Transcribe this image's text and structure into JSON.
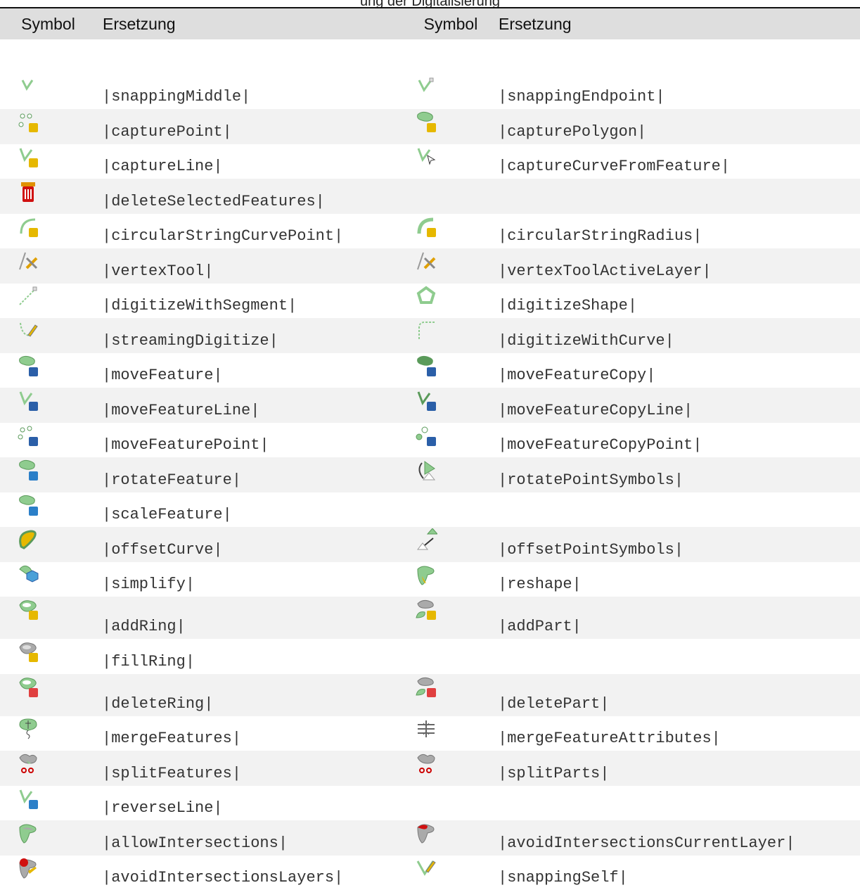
{
  "caption": "ung der Digitalisierung",
  "headers": {
    "symbol": "Symbol",
    "replacement": "Ersetzung"
  },
  "rows": [
    {
      "left": {
        "icon": "snapping-middle-icon",
        "code": "|snappingMiddle|"
      },
      "right": {
        "icon": "snapping-endpoint-icon",
        "code": "|snappingEndpoint|"
      }
    },
    {
      "left": {
        "icon": "capture-point-icon",
        "code": "|capturePoint|"
      },
      "right": {
        "icon": "capture-polygon-icon",
        "code": "|capturePolygon|"
      }
    },
    {
      "left": {
        "icon": "capture-line-icon",
        "code": "|captureLine|"
      },
      "right": {
        "icon": "capture-curve-from-feature-icon",
        "code": "|captureCurveFromFeature|"
      }
    },
    {
      "left": {
        "icon": "delete-selected-features-icon",
        "code": "|deleteSelectedFeatures|"
      },
      "right": null
    },
    {
      "left": {
        "icon": "circular-string-curve-point-icon",
        "code": "|circularStringCurvePoint|"
      },
      "right": {
        "icon": "circular-string-radius-icon",
        "code": "|circularStringRadius|"
      }
    },
    {
      "left": {
        "icon": "vertex-tool-icon",
        "code": "|vertexTool|"
      },
      "right": {
        "icon": "vertex-tool-active-layer-icon",
        "code": "|vertexToolActiveLayer|"
      }
    },
    {
      "left": {
        "icon": "digitize-with-segment-icon",
        "code": "|digitizeWithSegment|"
      },
      "right": {
        "icon": "digitize-shape-icon",
        "code": "|digitizeShape|"
      }
    },
    {
      "left": {
        "icon": "streaming-digitize-icon",
        "code": "|streamingDigitize|"
      },
      "right": {
        "icon": "digitize-with-curve-icon",
        "code": "|digitizeWithCurve|"
      }
    },
    {
      "left": {
        "icon": "move-feature-icon",
        "code": "|moveFeature|"
      },
      "right": {
        "icon": "move-feature-copy-icon",
        "code": "|moveFeatureCopy|"
      }
    },
    {
      "left": {
        "icon": "move-feature-line-icon",
        "code": "|moveFeatureLine|"
      },
      "right": {
        "icon": "move-feature-copy-line-icon",
        "code": "|moveFeatureCopyLine|"
      }
    },
    {
      "left": {
        "icon": "move-feature-point-icon",
        "code": "|moveFeaturePoint|"
      },
      "right": {
        "icon": "move-feature-copy-point-icon",
        "code": "|moveFeatureCopyPoint|"
      }
    },
    {
      "left": {
        "icon": "rotate-feature-icon",
        "code": "|rotateFeature|"
      },
      "right": {
        "icon": "rotate-point-symbols-icon",
        "code": "|rotatePointSymbols|"
      }
    },
    {
      "left": {
        "icon": "scale-feature-icon",
        "code": "|scaleFeature|"
      },
      "right": null
    },
    {
      "left": {
        "icon": "offset-curve-icon",
        "code": "|offsetCurve|"
      },
      "right": {
        "icon": "offset-point-symbols-icon",
        "code": "|offsetPointSymbols|"
      }
    },
    {
      "left": {
        "icon": "simplify-icon",
        "code": "|simplify|"
      },
      "right": {
        "icon": "reshape-icon",
        "code": "|reshape|"
      }
    },
    {
      "left": {
        "icon": "add-ring-icon",
        "code": "|addRing|"
      },
      "right": {
        "icon": "add-part-icon",
        "code": "|addPart|"
      }
    },
    {
      "left": {
        "icon": "fill-ring-icon",
        "code": "|fillRing|"
      },
      "right": null
    },
    {
      "left": {
        "icon": "delete-ring-icon",
        "code": "|deleteRing|"
      },
      "right": {
        "icon": "delete-part-icon",
        "code": "|deletePart|"
      }
    },
    {
      "left": {
        "icon": "merge-features-icon",
        "code": "|mergeFeatures|"
      },
      "right": {
        "icon": "merge-feature-attributes-icon",
        "code": "|mergeFeatureAttributes|"
      }
    },
    {
      "left": {
        "icon": "split-features-icon",
        "code": "|splitFeatures|"
      },
      "right": {
        "icon": "split-parts-icon",
        "code": "|splitParts|"
      }
    },
    {
      "left": {
        "icon": "reverse-line-icon",
        "code": "|reverseLine|"
      },
      "right": null
    },
    {
      "left": {
        "icon": "allow-intersections-icon",
        "code": "|allowIntersections|"
      },
      "right": {
        "icon": "avoid-intersections-current-layer-icon",
        "code": "|avoidIntersectionsCurrentLayer|"
      }
    },
    {
      "left": {
        "icon": "avoid-intersections-layers-icon",
        "code": "|avoidIntersectionsLayers|"
      },
      "right": {
        "icon": "snapping-self-icon",
        "code": "|snappingSelf|"
      }
    }
  ]
}
